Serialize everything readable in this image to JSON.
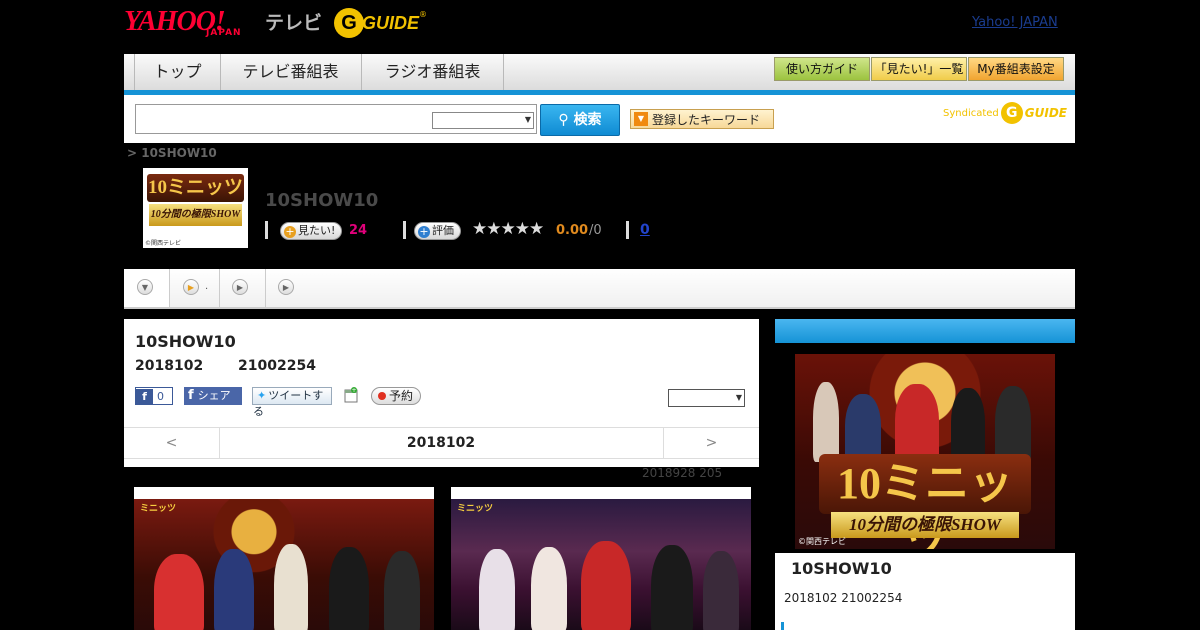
{
  "header": {
    "yahoo_logo": "YAHOO!",
    "yahoo_sub": "JAPAN",
    "tv_label": "テレビ",
    "gguide_logo": "GUIDE",
    "gguide_reg": "®",
    "top_link": "Yahoo! JAPAN"
  },
  "nav": {
    "tabs": [
      "トップ",
      "テレビ番組表",
      "ラジオ番組表"
    ],
    "buttons": [
      "使い方ガイド",
      "「見たい!」一覧",
      "My番組表設定"
    ]
  },
  "search": {
    "button_label": "検索",
    "keyword_button": "登録したキーワード",
    "syndicated_label": "Syndicated",
    "syndicated_logo": "GUIDE"
  },
  "breadcrumb": "> 10SHOW10",
  "program": {
    "title": "10SHOW10",
    "thumb_title": "10ミニッツ",
    "thumb_sub": "10分間の極限SHOW",
    "thumb_copy": "©関西テレビ",
    "want_label": "見たい!",
    "want_count": "24",
    "rate_label": "評価",
    "stars": "★★★★★",
    "rating": "0.00",
    "rating_count": "/0",
    "link_zero": "0"
  },
  "subtabs": {
    "second_label": "."
  },
  "main": {
    "title": "10SHOW10",
    "date": "2018102",
    "code": "21002254",
    "fb_count": "0",
    "fb_share": "シェア",
    "tweet": "ツイートする",
    "reserve": "予約",
    "pager_prev": "<",
    "pager_current": "2018102",
    "pager_next": ">",
    "stat_note": "2018928  205"
  },
  "side": {
    "title": "10SHOW10",
    "meta": "2018102  21002254",
    "logo": "10ミニッツ",
    "logo_sub": "10分間の極限SHOW",
    "copy": "©関西テレビ"
  },
  "colors": {
    "accent_blue": "#1593d6",
    "pink": "#e0007a",
    "rating_orange": "#e08a1e"
  }
}
